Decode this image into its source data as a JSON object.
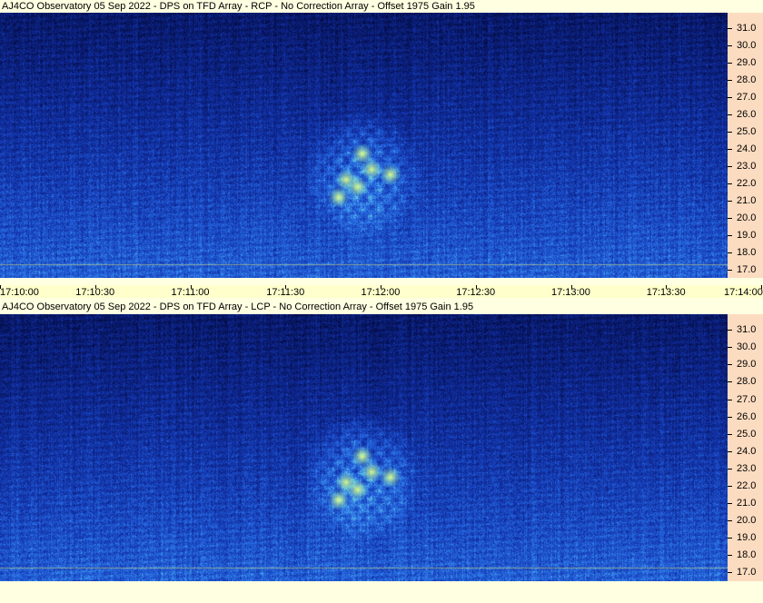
{
  "colors": {
    "background": "#ffffe1",
    "axis_bg": "#fcdcc0",
    "xaxis_bg": "#ffffcc",
    "signal_low": "#06145a",
    "signal_mid": "#2a6ad8",
    "signal_high": "#c8ff78"
  },
  "chart_data": [
    {
      "type": "heatmap",
      "title": "AJ4CO Observatory 05 Sep 2022 - DPS on TFD Array  - RCP  -  No Correction Array  -  Offset 1975  Gain 1.95",
      "xlabel": "",
      "ylabel": "",
      "x_ticks": [
        "17:10:00",
        "17:10:30",
        "17:11:00",
        "17:11:30",
        "17:12:00",
        "17:12:30",
        "17:13:00",
        "17:13:30",
        "17:14:00"
      ],
      "y_ticks": [
        "17.0",
        "18.0",
        "19.0",
        "20.0",
        "21.0",
        "22.0",
        "23.0",
        "24.0",
        "25.0",
        "26.0",
        "27.0",
        "28.0",
        "29.0",
        "30.0",
        "31.0"
      ],
      "ylim": [
        16.5,
        31.9
      ],
      "colormap": "dark blue to yellow-green (intensity)",
      "burst": {
        "t_start": "17:11:44",
        "t_end": "17:12:15",
        "f_low": 19.5,
        "f_high": 25.5
      }
    },
    {
      "type": "heatmap",
      "title": "AJ4CO Observatory 05 Sep 2022 - DPS on TFD Array  - LCP  -  No Correction Array  -  Offset 1975  Gain 1.95",
      "xlabel": "",
      "ylabel": "",
      "x_ticks": [],
      "y_ticks": [
        "17.0",
        "18.0",
        "19.0",
        "20.0",
        "21.0",
        "22.0",
        "23.0",
        "24.0",
        "25.0",
        "26.0",
        "27.0",
        "28.0",
        "29.0",
        "30.0",
        "31.0"
      ],
      "ylim": [
        16.5,
        31.9
      ],
      "colormap": "dark blue to yellow-green (intensity)",
      "burst": {
        "t_start": "17:11:44",
        "t_end": "17:12:15",
        "f_low": 19.5,
        "f_high": 25.5
      }
    }
  ]
}
